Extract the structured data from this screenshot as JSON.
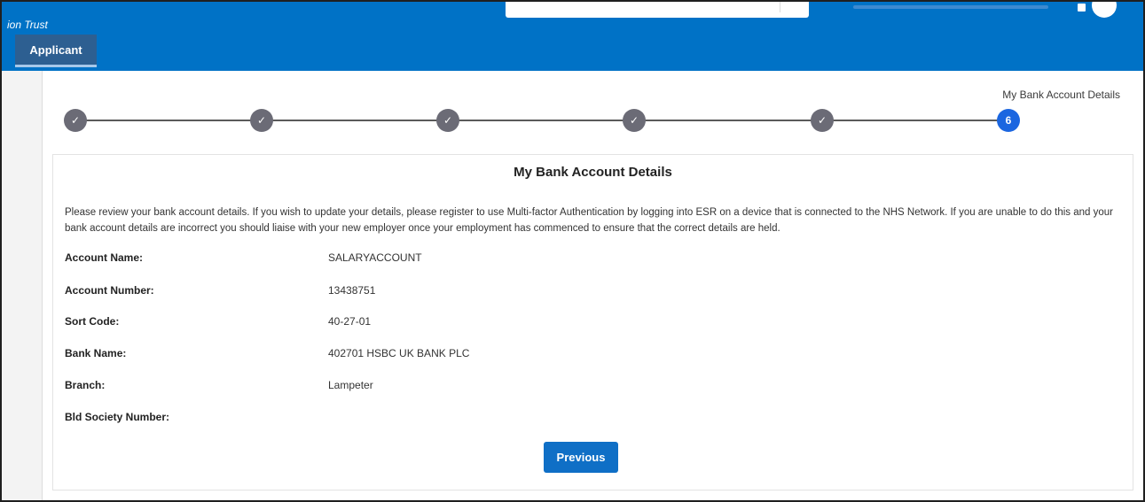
{
  "header": {
    "org_name": "ion Trust",
    "tab_label": "Applicant"
  },
  "progress": {
    "current_step_label": "My Bank Account Details",
    "steps": [
      {
        "state": "complete",
        "text": "✓"
      },
      {
        "state": "complete",
        "text": "✓"
      },
      {
        "state": "complete",
        "text": "✓"
      },
      {
        "state": "complete",
        "text": "✓"
      },
      {
        "state": "complete",
        "text": "✓"
      },
      {
        "state": "current",
        "text": "6"
      }
    ]
  },
  "panel": {
    "title": "My Bank Account Details",
    "intro": "Please review your bank account details. If you wish to update your details, please register to use Multi-factor Authentication by logging into ESR on a device that is connected to the NHS Network. If you are unable to do this and your bank account details are incorrect you should liaise with your new employer once your employment has commenced to ensure that the correct details are held.",
    "fields": [
      {
        "label": "Account Name:",
        "value": "SALARYACCOUNT"
      },
      {
        "label": "Account Number:",
        "value": "13438751"
      },
      {
        "label": "Sort Code:",
        "value": "40-27-01"
      },
      {
        "label": "Bank Name:",
        "value": "402701 HSBC UK BANK PLC"
      },
      {
        "label": "Branch:",
        "value": "Lampeter"
      },
      {
        "label": "Bld Society Number:",
        "value": ""
      }
    ],
    "previous_button": "Previous"
  },
  "colors": {
    "header_bg": "#0072c6",
    "tab_bg": "#2d5f91",
    "step_complete": "#6b6b76",
    "step_current": "#1b66e0",
    "button_bg": "#0f6fc6"
  }
}
